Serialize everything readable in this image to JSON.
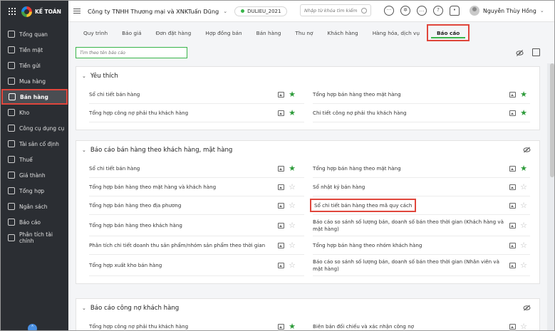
{
  "app": {
    "logo_text": "KẾ TOÁN"
  },
  "sidebar": {
    "items": [
      {
        "label": "Tổng quan",
        "icon": "dashboard-icon"
      },
      {
        "label": "Tiền mặt",
        "icon": "cash-icon"
      },
      {
        "label": "Tiền gửi",
        "icon": "bank-icon"
      },
      {
        "label": "Mua hàng",
        "icon": "purchase-icon"
      },
      {
        "label": "Bán hàng",
        "icon": "cart-icon",
        "active": true
      },
      {
        "label": "Kho",
        "icon": "warehouse-icon"
      },
      {
        "label": "Công cụ dụng cụ",
        "icon": "tools-icon"
      },
      {
        "label": "Tài sản cố định",
        "icon": "asset-icon"
      },
      {
        "label": "Thuế",
        "icon": "tax-icon"
      },
      {
        "label": "Giá thành",
        "icon": "cost-icon"
      },
      {
        "label": "Tổng hợp",
        "icon": "summary-icon"
      },
      {
        "label": "Ngân sách",
        "icon": "budget-icon"
      },
      {
        "label": "Báo cáo",
        "icon": "report-icon"
      },
      {
        "label": "Phân tích tài chính",
        "icon": "analysis-icon"
      }
    ]
  },
  "header": {
    "company": "Công ty TNHH Thương mại và XNKTuấn Dũng",
    "database": "DULIEU_2021",
    "search_placeholder": "Nhập từ khóa tìm kiếm",
    "user_name": "Nguyễn Thùy Hồng"
  },
  "tabs": [
    "Quy trình",
    "Báo giá",
    "Đơn đặt hàng",
    "Hợp đồng bán",
    "Bán hàng",
    "Thu nợ",
    "Khách hàng",
    "Hàng hóa, dịch vụ",
    "Báo cáo"
  ],
  "active_tab": 8,
  "filter": {
    "placeholder": "Tìm theo tên báo cáo"
  },
  "sections": [
    {
      "title": "Yêu thích",
      "rows": [
        [
          {
            "label": "Sổ chi tiết bán hàng",
            "fav": true
          },
          {
            "label": "Tổng hợp bán hàng theo mặt hàng",
            "fav": true
          }
        ],
        [
          {
            "label": "Tổng hợp công nợ phải thu khách hàng",
            "fav": true
          },
          {
            "label": "Chi tiết công nợ phải thu khách hàng",
            "fav": true
          }
        ]
      ]
    },
    {
      "title": "Báo cáo bán hàng theo khách hàng, mặt hàng",
      "rows": [
        [
          {
            "label": "Sổ chi tiết bán hàng",
            "fav": true
          },
          {
            "label": "Tổng hợp bán hàng theo mặt hàng",
            "fav": true
          }
        ],
        [
          {
            "label": "Tổng hợp bán hàng theo mặt hàng và khách hàng",
            "fav": false
          },
          {
            "label": "Sổ nhật ký bán hàng",
            "fav": false
          }
        ],
        [
          {
            "label": "Tổng hợp bán hàng theo địa phương",
            "fav": false
          },
          {
            "label": "Sổ chi tiết bán hàng theo mã quy cách",
            "fav": false,
            "highlight": true
          }
        ],
        [
          {
            "label": "Tổng hợp bán hàng theo khách hàng",
            "fav": false
          },
          {
            "label": "Báo cáo so sánh số lượng bán, doanh số bán theo thời gian (Khách hàng và mặt hàng)",
            "fav": false
          }
        ],
        [
          {
            "label": "Phân tích chi tiết doanh thu sản phẩm/nhóm sản phẩm theo thời gian",
            "fav": false
          },
          {
            "label": "Tổng hợp bán hàng theo nhóm khách hàng",
            "fav": false
          }
        ],
        [
          {
            "label": "Tổng hợp xuất kho bán hàng",
            "fav": false
          },
          {
            "label": "Báo cáo so sánh số lượng bán, doanh số bán theo thời gian (Nhân viên và mặt hàng)",
            "fav": false
          }
        ]
      ]
    },
    {
      "title": "Báo cáo công nợ khách hàng",
      "rows": [
        [
          {
            "label": "Tổng hợp công nợ phải thu khách hàng",
            "fav": true
          },
          {
            "label": "Biên bản đối chiếu và xác nhận công nợ",
            "fav": false
          }
        ]
      ]
    }
  ],
  "colors": {
    "accent_green": "#39b54a",
    "highlight_red": "#e0463c",
    "sidebar_bg": "#2b2e33"
  }
}
